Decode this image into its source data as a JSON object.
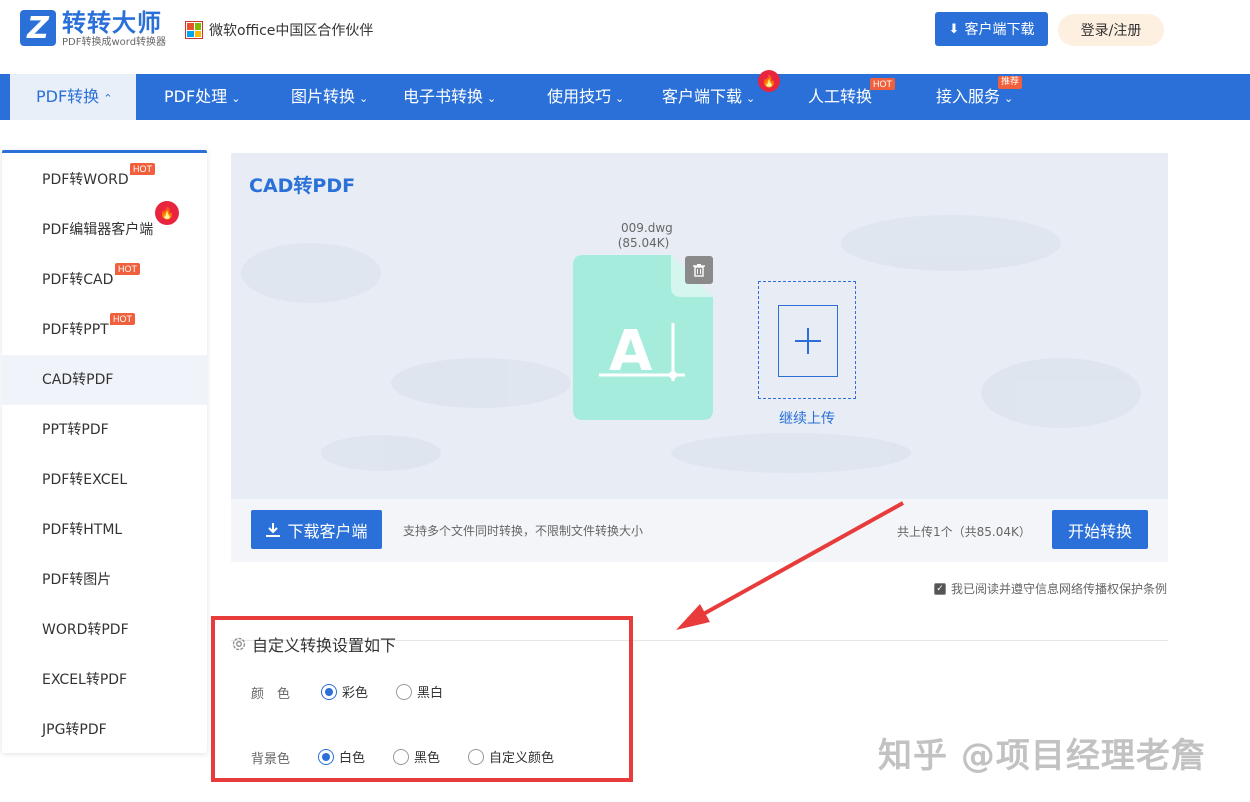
{
  "header": {
    "logo_title": "转转大师",
    "logo_sub": "PDF转换成word转换器",
    "partner": "微软office中国区合作伙伴",
    "download_label": "客户端下载",
    "login_label": "登录/注册"
  },
  "nav": {
    "items": [
      {
        "label": "PDF转换",
        "chevron": "⌃"
      },
      {
        "label": "PDF处理",
        "chevron": "⌄"
      },
      {
        "label": "图片转换",
        "chevron": "⌄"
      },
      {
        "label": "电子书转换",
        "chevron": "⌄"
      },
      {
        "label": "使用技巧",
        "chevron": "⌄"
      },
      {
        "label": "客户端下载",
        "chevron": "⌄"
      },
      {
        "label": "人工转换",
        "chevron": ""
      },
      {
        "label": "接入服务",
        "chevron": "⌄"
      }
    ],
    "hot_badge": "HOT",
    "rec_badge": "推荐"
  },
  "sidebar": {
    "items": [
      {
        "label": "PDF转WORD"
      },
      {
        "label": "PDF编辑器客户端"
      },
      {
        "label": "PDF转CAD"
      },
      {
        "label": "PDF转PPT"
      },
      {
        "label": "CAD转PDF"
      },
      {
        "label": "PPT转PDF"
      },
      {
        "label": "PDF转EXCEL"
      },
      {
        "label": "PDF转HTML"
      },
      {
        "label": "PDF转图片"
      },
      {
        "label": "WORD转PDF"
      },
      {
        "label": "EXCEL转PDF"
      },
      {
        "label": "JPG转PDF"
      }
    ],
    "hot_badge": "HOT"
  },
  "panel": {
    "title": "CAD转PDF",
    "file_name": "009.dwg",
    "file_size": "(85.04K)",
    "upload_more": "继续上传"
  },
  "bottom_bar": {
    "client_button": "下载客户端",
    "support_text": "支持多个文件同时转换，不限制文件转换大小",
    "count_text": "共上传1个（共85.04K）",
    "start_button": "开始转换"
  },
  "agreement": "我已阅读并遵守信息网络传播权保护条例",
  "settings": {
    "title": "自定义转换设置如下",
    "color_label": "颜　色",
    "color_options": [
      "彩色",
      "黑白"
    ],
    "bg_label": "背景色",
    "bg_options": [
      "白色",
      "黑色",
      "自定义颜色"
    ]
  },
  "watermark": "知乎 @项目经理老詹",
  "colors": {
    "brand": "#2a70d8",
    "hot": "#f0603c",
    "annotation": "#e83b3b",
    "file_card": "#a6ecdc"
  }
}
